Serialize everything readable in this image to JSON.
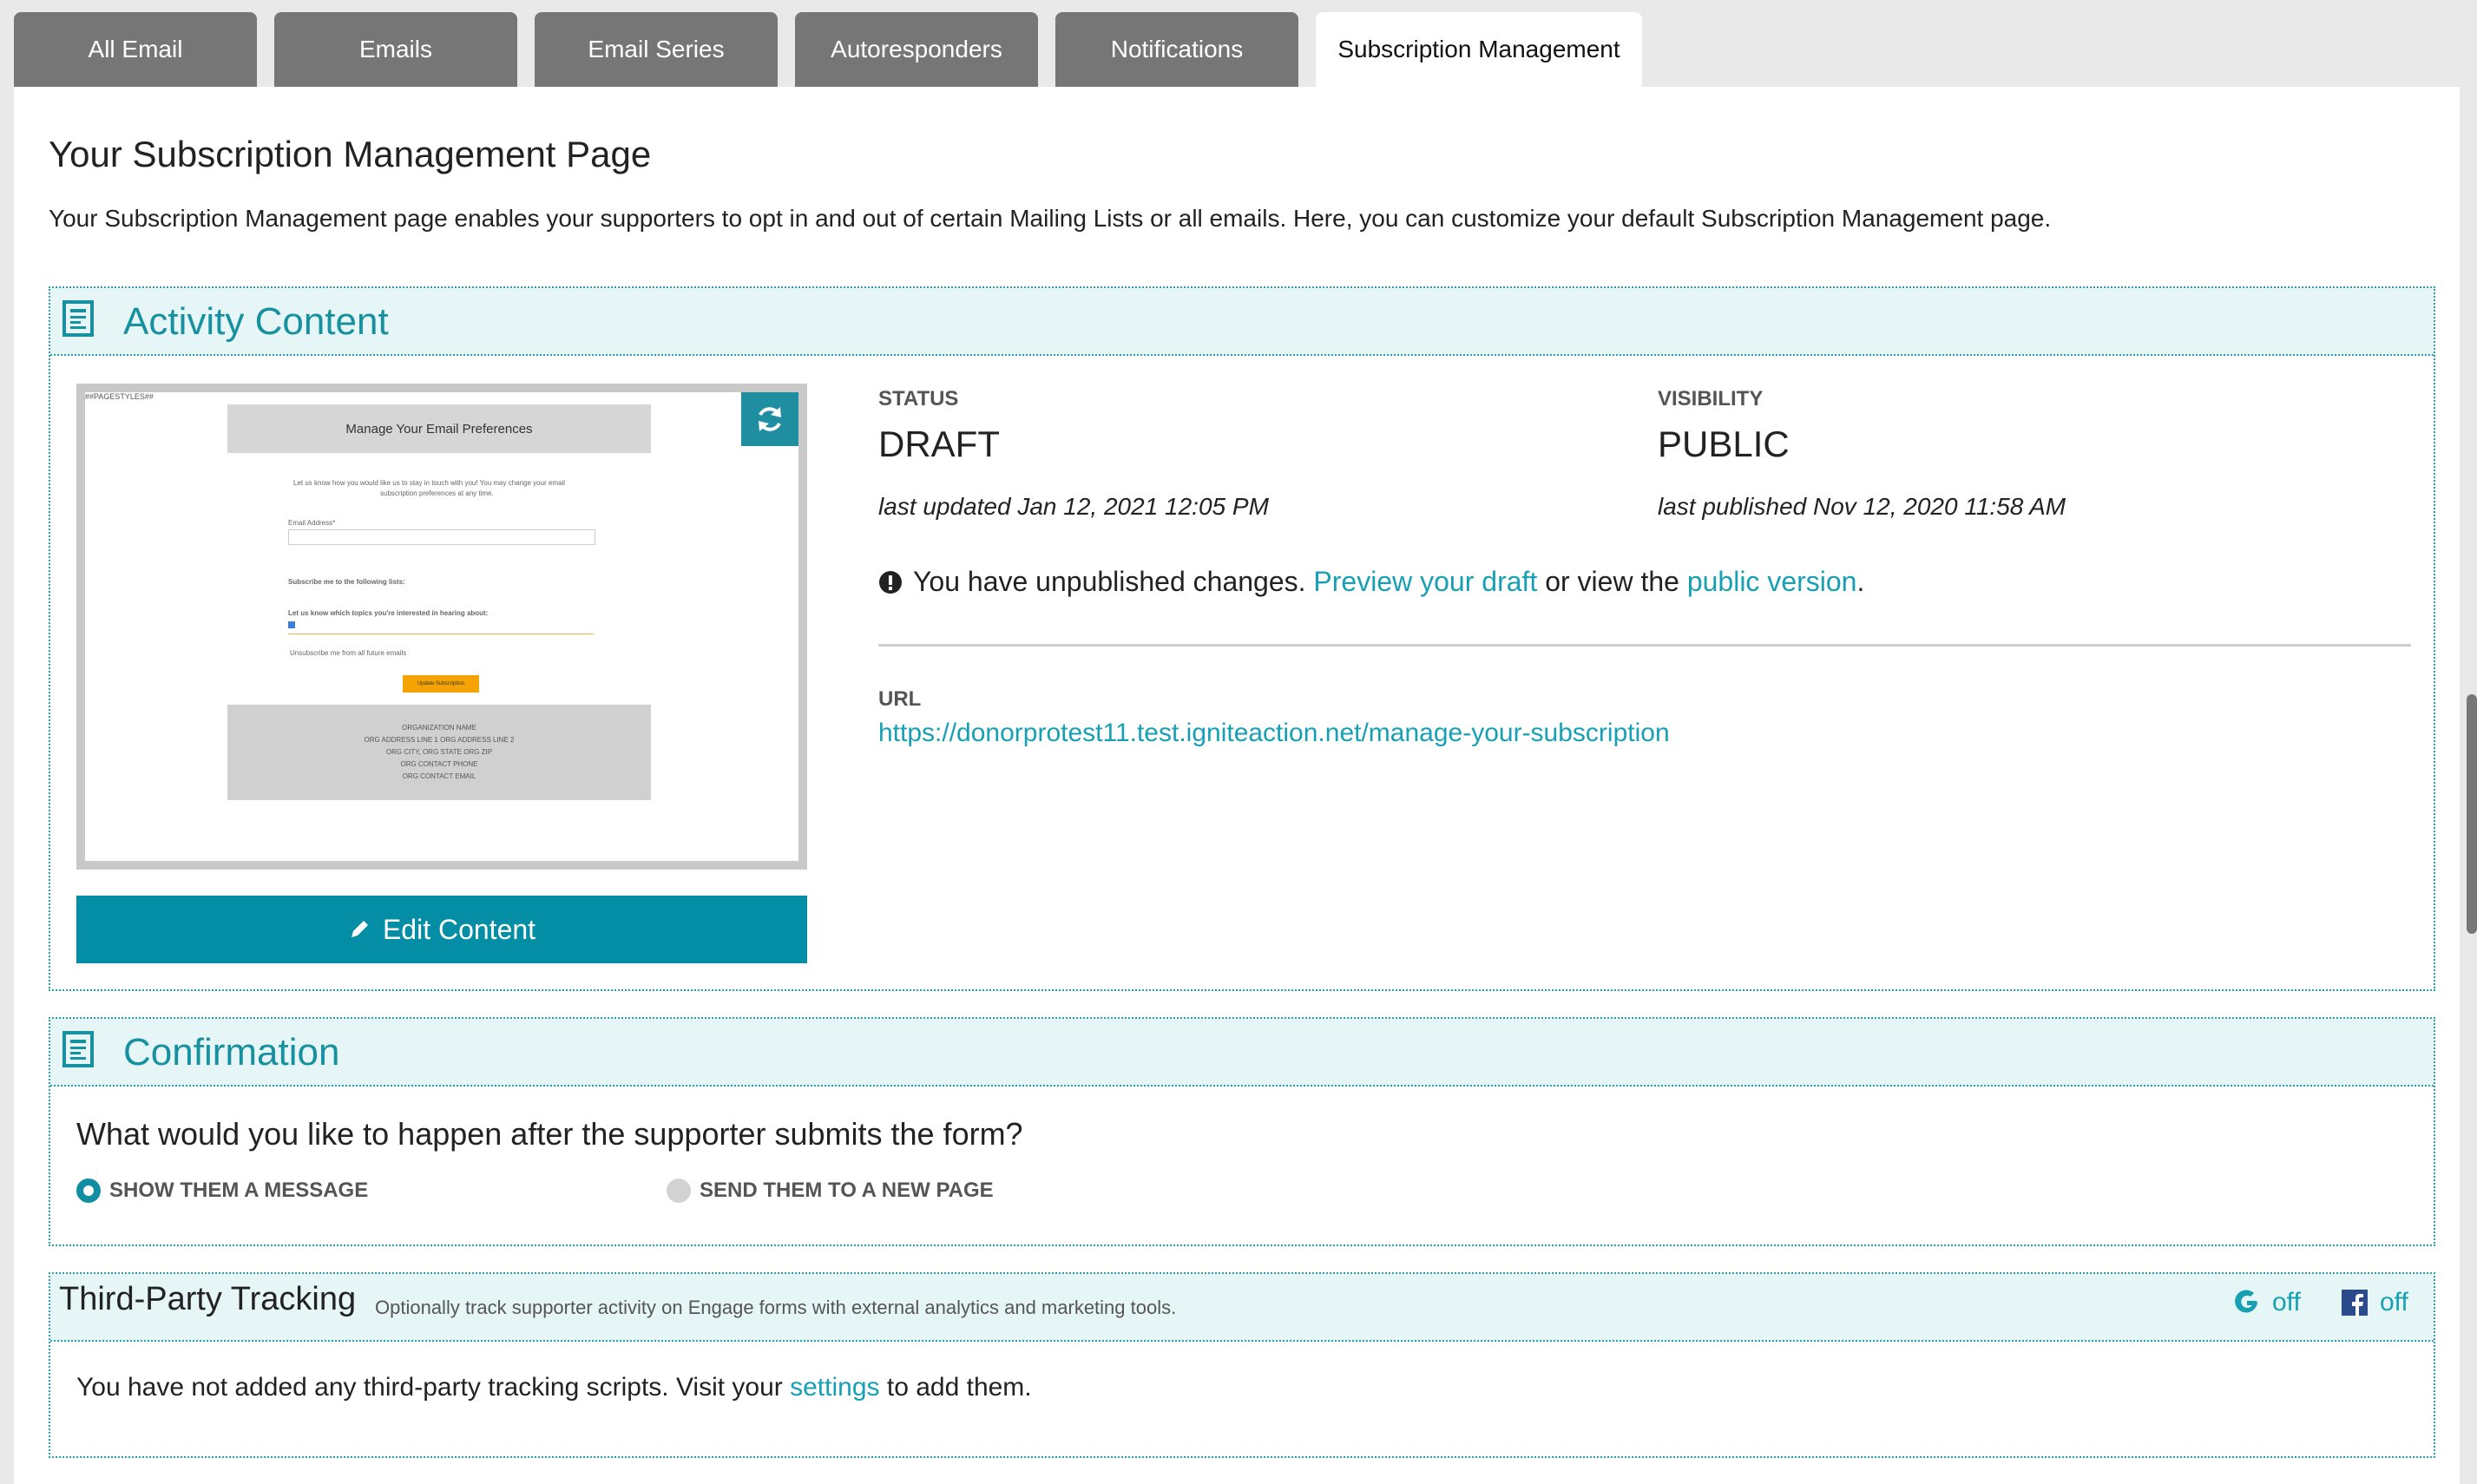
{
  "tabs": [
    {
      "label": "All Email"
    },
    {
      "label": "Emails"
    },
    {
      "label": "Email Series"
    },
    {
      "label": "Autoresponders"
    },
    {
      "label": "Notifications"
    },
    {
      "label": "Subscription Management"
    }
  ],
  "page": {
    "title": "Your Subscription Management Page",
    "description": "Your Subscription Management page enables your supporters to opt in and out of certain Mailing Lists or all emails. Here, you can customize your default Subscription Management page."
  },
  "activity": {
    "title": "Activity Content",
    "preview": {
      "template_tag": "##PAGESTYLES##",
      "heading": "Manage Your Email Preferences",
      "intro_line1": "Let us know how you would like us to stay in touch with you! You may change your email",
      "intro_line2": "subscription preferences at any time.",
      "email_label": "Email Address*",
      "lists_label": "Subscribe me to the following lists:",
      "topics_label": "Let us know which topics you're interested in hearing about:",
      "unsubscribe_label": "Unsubscribe me from all future emails",
      "button_label": "Update Subscription",
      "footer_lines": [
        "ORGANIZATION NAME",
        "ORG ADDRESS LINE 1 ORG ADDRESS LINE 2",
        "ORG CITY, ORG STATE ORG ZIP",
        "ORG CONTACT PHONE",
        "ORG CONTACT EMAIL"
      ]
    },
    "edit_button": "Edit Content",
    "status_label": "STATUS",
    "status_value": "DRAFT",
    "last_updated": "last updated Jan 12, 2021 12:05 PM",
    "visibility_label": "VISIBILITY",
    "visibility_value": "PUBLIC",
    "last_published": "last published Nov 12, 2020 11:58 AM",
    "notice_text_1": "You have unpublished changes.",
    "notice_link_1": "Preview your draft",
    "notice_text_2": "or view the",
    "notice_link_2": "public version",
    "notice_text_3": ".",
    "url_label": "URL",
    "url": "https://donorprotest11.test.igniteaction.net/manage-your-subscription"
  },
  "confirmation": {
    "title": "Confirmation",
    "question": "What would you like to happen after the supporter submits the form?",
    "option_message": "SHOW THEM A MESSAGE",
    "option_page": "SEND THEM TO A NEW PAGE",
    "selected": "SHOW THEM A MESSAGE"
  },
  "tracking": {
    "title": "Third-Party Tracking",
    "subtitle": "Optionally track supporter activity on Engage forms with external analytics and marketing tools.",
    "google_status": "off",
    "facebook_status": "off",
    "body_1": "You have not added any third-party tracking scripts. Visit your",
    "body_link": "settings",
    "body_2": "to add them."
  },
  "colors": {
    "accent": "#17a0b4",
    "button": "#048ea6",
    "tab_inactive": "#767676",
    "section_header_bg": "#e6f6f6"
  }
}
